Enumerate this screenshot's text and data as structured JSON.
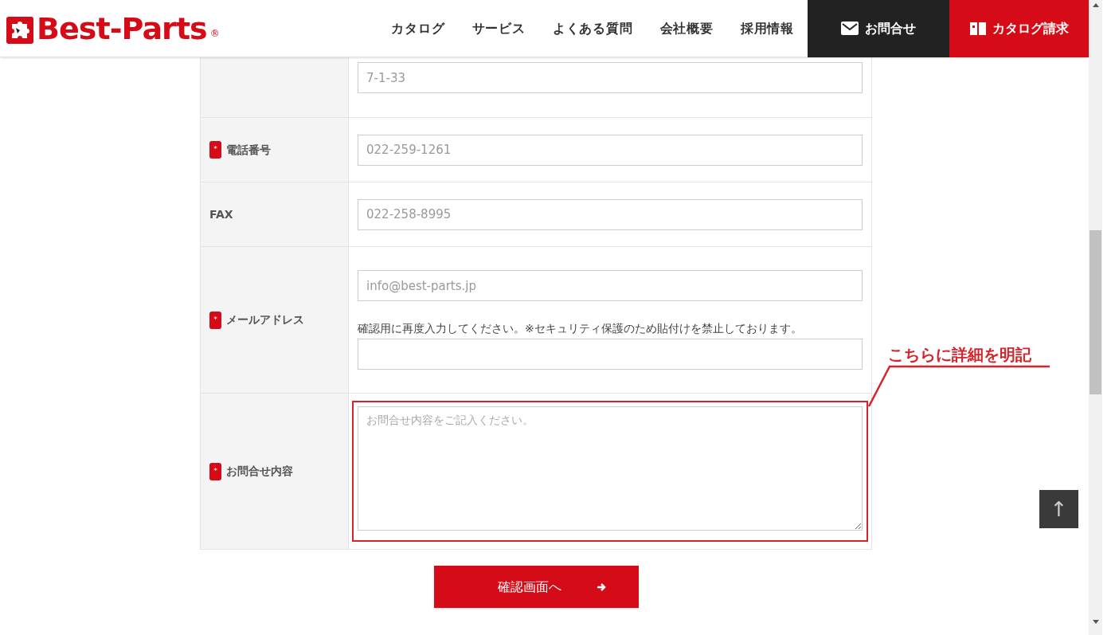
{
  "header": {
    "logo": {
      "text": "Best-Parts",
      "mark": "®"
    },
    "nav": [
      "カタログ",
      "サービス",
      "よくある質問",
      "会社概要",
      "採用情報"
    ],
    "contact_button": "お問合せ",
    "catalog_button": "カタログ請求"
  },
  "form": {
    "rows": [
      {
        "kind": "single",
        "fields": [
          {
            "placeholder": "7-1-33"
          }
        ]
      },
      {
        "kind": "single",
        "label": "電話番号",
        "required_mark": "*",
        "fields": [
          {
            "placeholder": "022-259-1261"
          }
        ]
      },
      {
        "kind": "single",
        "label": "FAX",
        "fields": [
          {
            "placeholder": "022-258-8995"
          }
        ]
      },
      {
        "kind": "email",
        "label": "メールアドレス",
        "required_mark": "*",
        "fields": [
          {
            "placeholder": "info@best-parts.jp"
          },
          {
            "note": "確認用に再度入力してください。※セキュリティ保護のため貼付けを禁止しております。"
          }
        ]
      },
      {
        "kind": "textarea",
        "label": "お問合せ内容",
        "required_mark": "*",
        "highlighted": true,
        "fields": [
          {
            "placeholder": "お問合せ内容をご記入ください。"
          }
        ]
      }
    ],
    "submit_button": "確認画面へ"
  },
  "annotation": "こちらに詳細を明記",
  "page_top_button": "↑"
}
